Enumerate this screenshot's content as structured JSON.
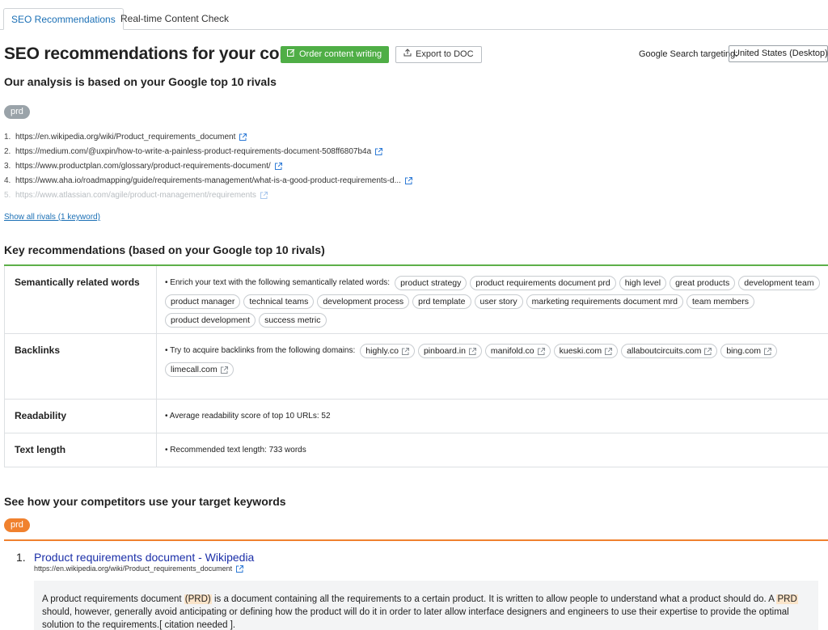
{
  "tabs": [
    {
      "label": "SEO Recommendations",
      "active": true
    },
    {
      "label": "Real-time Content Check",
      "active": false
    }
  ],
  "header": {
    "title": "SEO recommendations for your content",
    "order_label": "Order content writing",
    "export_label": "Export to DOC",
    "targeting_label": "Google Search targeting:",
    "targeting_value": "United States (Desktop)"
  },
  "analysis": {
    "subtitle": "Our analysis is based on your Google top 10 rivals",
    "keyword": "prd",
    "rivals": [
      {
        "num": "1.",
        "url": "https://en.wikipedia.org/wiki/Product_requirements_document"
      },
      {
        "num": "2.",
        "url": "https://medium.com/@uxpin/how-to-write-a-painless-product-requirements-document-508ff6807b4a"
      },
      {
        "num": "3.",
        "url": "https://www.productplan.com/glossary/product-requirements-document/"
      },
      {
        "num": "4.",
        "url": "https://www.aha.io/roadmapping/guide/requirements-management/what-is-a-good-product-requirements-d..."
      },
      {
        "num": "5.",
        "url": "https://www.atlassian.com/agile/product-management/requirements"
      }
    ],
    "show_all": "Show all rivals (1 keyword)"
  },
  "key_recs": {
    "title": "Key recommendations (based on your Google top 10 rivals)",
    "semantic": {
      "heading": "Semantically related words",
      "lead": "• Enrich your text with the following semantically related words:",
      "words": [
        "product strategy",
        "product requirements document prd",
        "high level",
        "great products",
        "development team",
        "product manager",
        "technical teams",
        "development process",
        "prd template",
        "user story",
        "marketing requirements document mrd",
        "team members",
        "product development",
        "success metric"
      ]
    },
    "backlinks": {
      "heading": "Backlinks",
      "lead": "• Try to acquire backlinks from the following domains:",
      "domains": [
        "highly.co",
        "pinboard.in",
        "manifold.co",
        "kueski.com",
        "allaboutcircuits.com",
        "bing.com",
        "limecall.com"
      ]
    },
    "readability": {
      "heading": "Readability",
      "text": "• Average readability score of top 10 URLs:  52"
    },
    "text_length": {
      "heading": "Text length",
      "text": "• Recommended text length:  733 words"
    }
  },
  "competitors": {
    "title": "See how your competitors use your target keywords",
    "keyword": "prd",
    "results": [
      {
        "num": "1.",
        "title": "Product requirements document - Wikipedia",
        "url": "https://en.wikipedia.org/wiki/Product_requirements_document",
        "snippet_parts": [
          "A product requirements document ",
          "(PRD)",
          " is a document containing all the requirements to a certain product. It is written to allow people to understand what a product should do. A ",
          "PRD",
          " should, however, generally avoid anticipating or defining how the product will do it in order to later allow interface designers and engineers to use their expertise to provide the optimal solution to the requirements.[ citation needed ]."
        ]
      }
    ]
  },
  "colors": {
    "accent_blue": "#1a6fb5",
    "order_green": "#4fae46",
    "section_green": "#5db049",
    "orange": "#f0812e",
    "link_title": "#1b2fa8"
  }
}
